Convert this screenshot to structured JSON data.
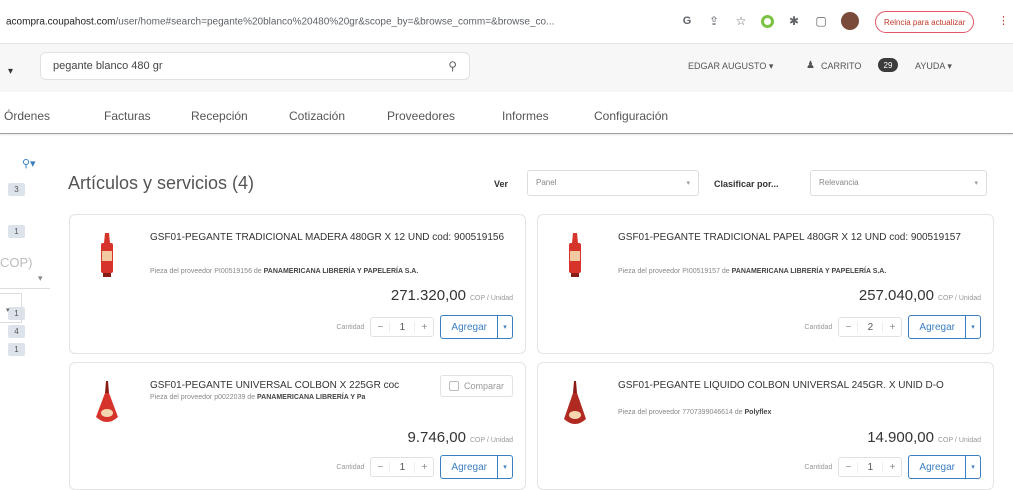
{
  "browser": {
    "url_host": "acompra.coupahost.com",
    "url_path": "/user/home#search=pegante%20blanco%20480%20gr&scope_by=&browse_comm=&browse_co...",
    "update_button": "Relncia para actualizar"
  },
  "header": {
    "search_value": "pegante blanco 480 gr",
    "user": "EDGAR AUGUSTO",
    "cart_label": "CARRITO",
    "cart_count": "29",
    "help": "AYUDA"
  },
  "nav": [
    "Órdenes",
    "Facturas",
    "Recepción",
    "Cotización",
    "Proveedores",
    "Informes",
    "Configuración"
  ],
  "sidebar": {
    "badges": [
      "3",
      "1",
      "1",
      "4",
      "1"
    ],
    "currency": "COP)"
  },
  "main": {
    "title": "Artículos y servicios (4)",
    "view_label": "Ver",
    "view_value": "Panel",
    "sort_label": "Clasificar por...",
    "sort_value": "Relevancia"
  },
  "products": [
    {
      "name": "GSF01-PEGANTE TRADICIONAL MADERA 480GR X 12 UND cod: 900519156",
      "supplier_prefix": "Pieza del proveedor PI00519156 de ",
      "supplier": "PANAMERICANA LIBRERÍA Y PAPELERÍA S.A.",
      "price": "271.320,00",
      "unit": "COP / Unidad",
      "qty_label": "Cantidad",
      "qty": "1",
      "add_label": "Agregar"
    },
    {
      "name": "GSF01-PEGANTE TRADICIONAL PAPEL 480GR X 12 UND cod: 900519157",
      "supplier_prefix": "Pieza del proveedor PI00519157 de ",
      "supplier": "PANAMERICANA LIBRERÍA Y PAPELERÍA S.A.",
      "price": "257.040,00",
      "unit": "COP / Unidad",
      "qty_label": "Cantidad",
      "qty": "2",
      "add_label": "Agregar"
    },
    {
      "name": "GSF01-PEGANTE UNIVERSAL COLBON X 225GR coc",
      "supplier_prefix": "Pieza del proveedor p0022039 de ",
      "supplier": "PANAMERICANA LIBRERÍA Y Pa",
      "price": "9.746,00",
      "unit": "COP / Unidad",
      "qty_label": "Cantidad",
      "qty": "1",
      "add_label": "Agregar",
      "compare_label": "Comparar"
    },
    {
      "name": "GSF01-PEGANTE LIQUIDO COLBON UNIVERSAL 245GR. X UNID D-O",
      "supplier_prefix": "Pieza del proveedor 7707399046614 de ",
      "supplier": "Polyflex",
      "price": "14.900,00",
      "unit": "COP / Unidad",
      "qty_label": "Cantidad",
      "qty": "1",
      "add_label": "Agregar"
    }
  ],
  "colors": {
    "accent": "#3a7fc1",
    "glue_red": "#d6342a",
    "glue_dark": "#8a1c16"
  }
}
